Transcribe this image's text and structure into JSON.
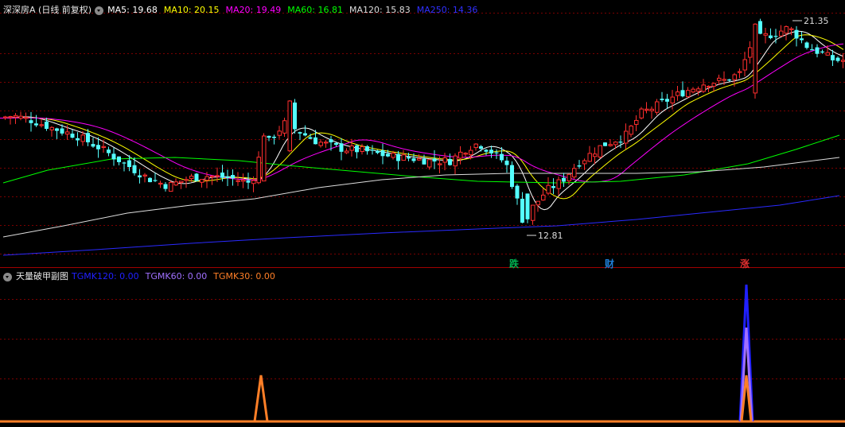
{
  "main_panel": {
    "title": "深深房A (日线 前复权)",
    "ma_items": [
      {
        "label": "MA5: 19.68",
        "color": "#ffffff"
      },
      {
        "label": "MA10: 20.15",
        "color": "#ffff00"
      },
      {
        "label": "MA20: 19.49",
        "color": "#ff00ff"
      },
      {
        "label": "MA60: 16.81",
        "color": "#00ff00"
      },
      {
        "label": "MA120: 15.83",
        "color": "#dddddd"
      },
      {
        "label": "MA250: 14.36",
        "color": "#3030ff"
      }
    ],
    "high_label": "21.35",
    "low_label": "12.81",
    "markers": [
      {
        "text": "跌",
        "color": "#00b050"
      },
      {
        "text": "财",
        "color": "#1e7fd9"
      },
      {
        "text": "涨",
        "color": "#e03030"
      }
    ]
  },
  "sub_panel": {
    "title": "天量破甲副图",
    "items": [
      {
        "label": "TGMK120: 0.00",
        "color": "#2020ff"
      },
      {
        "label": "TGMK60: 0.00",
        "color": "#a070ff"
      },
      {
        "label": "TGMK30: 0.00",
        "color": "#ff7f27"
      }
    ]
  },
  "colors": {
    "up": "#ff2e2e",
    "down": "#54ffff",
    "grid": "#7a0000"
  },
  "chart_data": {
    "type": "candlestick",
    "price_extremes": {
      "high": 21.35,
      "low": 12.81
    },
    "ma_latest": {
      "MA5": 19.68,
      "MA10": 20.15,
      "MA20": 19.49,
      "MA60": 16.81,
      "MA120": 15.83,
      "MA250": 14.36
    },
    "indicator_latest": {
      "TGMK120": 0.0,
      "TGMK60": 0.0,
      "TGMK30": 0.0
    }
  }
}
